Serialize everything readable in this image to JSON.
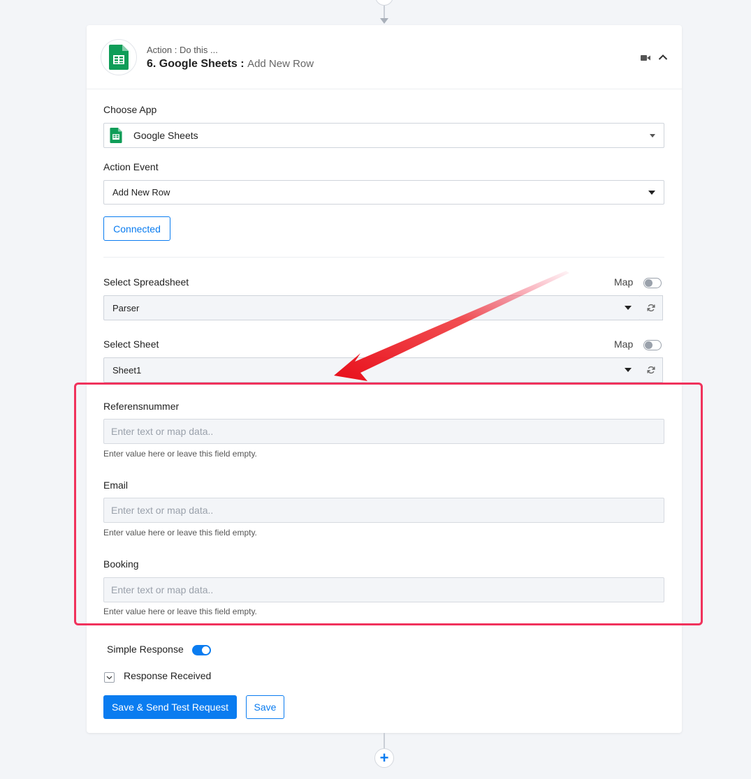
{
  "header": {
    "subtitle": "Action : Do this ...",
    "step_number": "6.",
    "app_name": "Google Sheets",
    "separator": ":",
    "action_name": "Add New Row",
    "icons": [
      "google-sheets-icon",
      "video-icon",
      "chevron-up-icon"
    ]
  },
  "choose_app": {
    "label": "Choose App",
    "value": "Google Sheets"
  },
  "action_event": {
    "label": "Action Event",
    "value": "Add New Row"
  },
  "connection": {
    "button_label": "Connected"
  },
  "spreadsheet": {
    "label": "Select Spreadsheet",
    "map_label": "Map",
    "map_enabled": false,
    "value": "Parser"
  },
  "sheet": {
    "label": "Select Sheet",
    "map_label": "Map",
    "map_enabled": false,
    "value": "Sheet1"
  },
  "fields": [
    {
      "label": "Referensnummer",
      "placeholder": "Enter text or map data..",
      "hint": "Enter value here or leave this field empty."
    },
    {
      "label": "Email",
      "placeholder": "Enter text or map data..",
      "hint": "Enter value here or leave this field empty."
    },
    {
      "label": "Booking",
      "placeholder": "Enter text or map data..",
      "hint": "Enter value here or leave this field empty."
    }
  ],
  "simple_response": {
    "label": "Simple Response",
    "enabled": true
  },
  "response_received": {
    "label": "Response Received"
  },
  "actions": {
    "primary_label": "Save & Send Test Request",
    "secondary_label": "Save"
  },
  "colors": {
    "accent": "#0a7cf0",
    "sheets_green": "#0f9d58",
    "highlight": "#f0325c"
  }
}
